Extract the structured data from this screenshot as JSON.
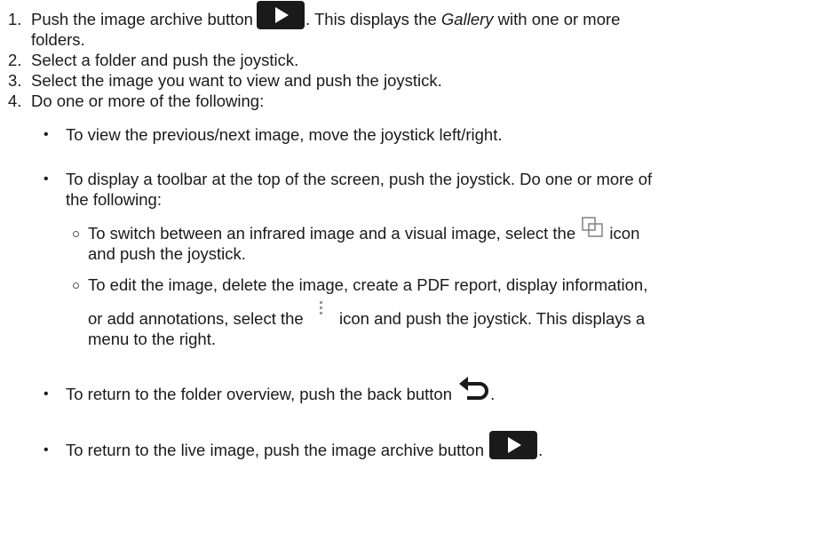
{
  "steps": [
    {
      "number": "1.",
      "text_before_icon": "Push the image archive button",
      "icon": "play-button-icon",
      "text_after_icon": ". This displays the",
      "emph": "Gallery",
      "text_tail": "with one or more",
      "text_line2": "folders."
    },
    {
      "number": "2.",
      "text": "Select a folder and push the joystick."
    },
    {
      "number": "3.",
      "text": "Select the image you want to view and push the joystick."
    },
    {
      "number": "4.",
      "text": "Do one or more of the following:"
    }
  ],
  "bullets": {
    "prev_next": "To view the previous/next image, move the joystick left/right.",
    "toolbar_line1": "To display a toolbar at the top of the screen, push the joystick. Do one or more of",
    "toolbar_line2": "the following:",
    "switch_before_icon": "To switch between an infrared image and a visual image, select the",
    "switch_icon": "overlapping-squares-icon",
    "switch_after_icon": "icon",
    "switch_line2": "and push the joystick.",
    "edit_line1": "To edit the image, delete the image, create a PDF report, display information,",
    "edit_before_icon": "or add annotations, select the",
    "edit_icon": "vertical-dots-menu-icon",
    "edit_after_icon": "icon and push the joystick. This displays a",
    "edit_line3": "menu to the right.",
    "back_before_icon": "To return to the folder overview, push the back button",
    "back_icon": "back-arrow-icon",
    "back_after_icon": ".",
    "live_before_icon": "To return to the live image, push the image archive button",
    "live_icon": "play-button-icon",
    "live_after_icon": "."
  },
  "colors": {
    "text": "#1a1a1a",
    "icon_dark": "#1a1a1a",
    "icon_gray": "#888888"
  }
}
